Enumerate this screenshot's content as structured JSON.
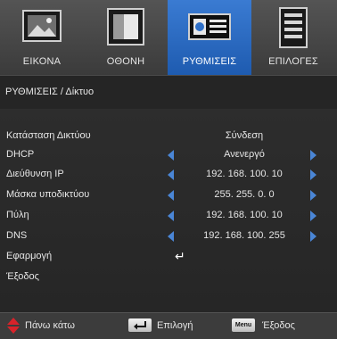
{
  "tabs": [
    {
      "label": "ΕΙΚΟΝΑ",
      "icon": "picture-icon"
    },
    {
      "label": "ΟΘΟΝΗ",
      "icon": "screen-icon"
    },
    {
      "label": "ΡΥΘΜΙΣΕΙΣ",
      "icon": "setup-icon",
      "active": true
    },
    {
      "label": "ΕΠΙΛΟΓΕΣ",
      "icon": "options-icon"
    }
  ],
  "breadcrumb": "ΡΥΘΜΙΣΕΙΣ / Δίκτυο",
  "rows": [
    {
      "label": "Κατάσταση Δικτύου",
      "value": "Σύνδεση"
    },
    {
      "label": "DHCP",
      "value": "Ανενεργό"
    },
    {
      "label": "Διεύθυνση IP",
      "value": "192. 168. 100. 10"
    },
    {
      "label": "Μάσκα υποδικτύου",
      "value": "255. 255. 0. 0"
    },
    {
      "label": "Πύλη",
      "value": "192. 168. 100. 10"
    },
    {
      "label": "DNS",
      "value": "192. 168. 100. 255"
    },
    {
      "label": "Εφαρμογή",
      "value": "↵"
    },
    {
      "label": "Έξοδος",
      "value": ""
    }
  ],
  "footer": {
    "nav_label": "Πάνω κάτω",
    "select_label": "Επιλογή",
    "menu_key": "Menu",
    "exit_label": "Έξοδος"
  },
  "colors": {
    "accent": "#2d6fc8",
    "arrow": "#4a86d6",
    "updown": "#d8232a"
  }
}
